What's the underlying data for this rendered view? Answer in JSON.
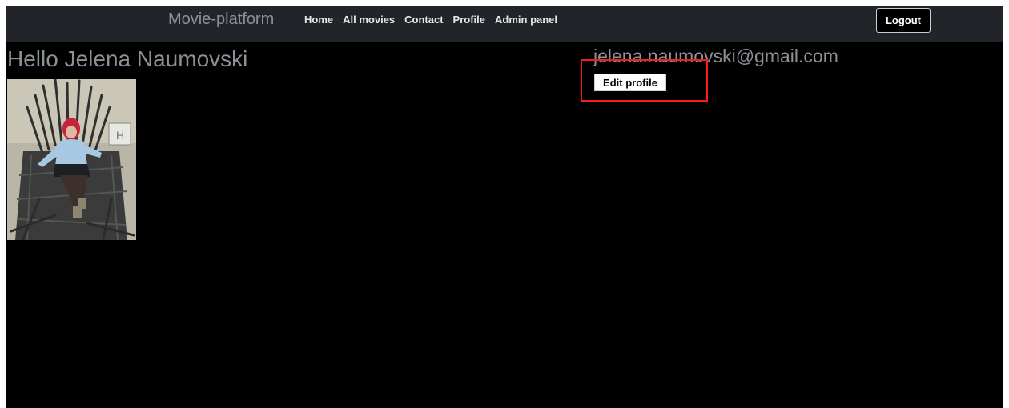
{
  "navbar": {
    "brand": "Movie-platform",
    "links": [
      "Home",
      "All movies",
      "Contact",
      "Profile",
      "Admin panel"
    ],
    "logout_label": "Logout"
  },
  "profile": {
    "greeting": "Hello Jelena Naumovski",
    "email": "jelena.naumovski@gmail.com",
    "edit_label": "Edit profile",
    "avatar": "profile-photo"
  },
  "colors": {
    "navbar_bg": "#212529",
    "page_bg": "#000000",
    "muted_text": "#8c9196",
    "highlight": "#ff1a1a"
  }
}
